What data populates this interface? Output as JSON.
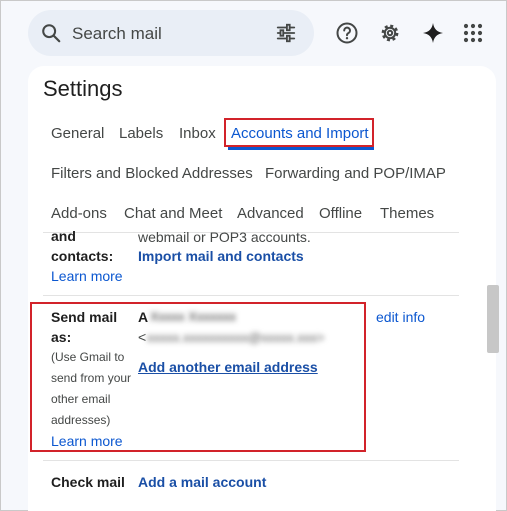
{
  "search": {
    "placeholder": "Search mail"
  },
  "header_icons": [
    "help-icon",
    "gear-icon",
    "gemini-sparkle-icon",
    "apps-grid-icon"
  ],
  "settings": {
    "title": "Settings",
    "tabs_row1": [
      "General",
      "Labels",
      "Inbox",
      "Accounts and Import"
    ],
    "tabs_row2": [
      "Filters and Blocked Addresses",
      "Forwarding and POP/IMAP"
    ],
    "tabs_row3": [
      "Add-ons",
      "Chat and Meet",
      "Advanced",
      "Offline",
      "Themes"
    ],
    "active_tab": "Accounts and Import"
  },
  "import_section": {
    "label_line1": "and",
    "label_line2": "contacts:",
    "learn_more": "Learn more",
    "desc_cut": "webmail or POP3 accounts.",
    "action": "Import mail and contacts"
  },
  "send_mail": {
    "label_line1": "Send mail",
    "label_line2": "as:",
    "hint": [
      "(Use Gmail to",
      "send from your",
      "other email",
      "addresses)"
    ],
    "learn_more": "Learn more",
    "name_blurred": "A     ",
    "email_blurred": "<",
    "edit_info": "edit info",
    "add_address": "Add another email address"
  },
  "check_mail": {
    "label": "Check mail",
    "action": "Add a mail account"
  },
  "colors": {
    "accent": "#0b57d0",
    "highlight": "#d2232a"
  }
}
